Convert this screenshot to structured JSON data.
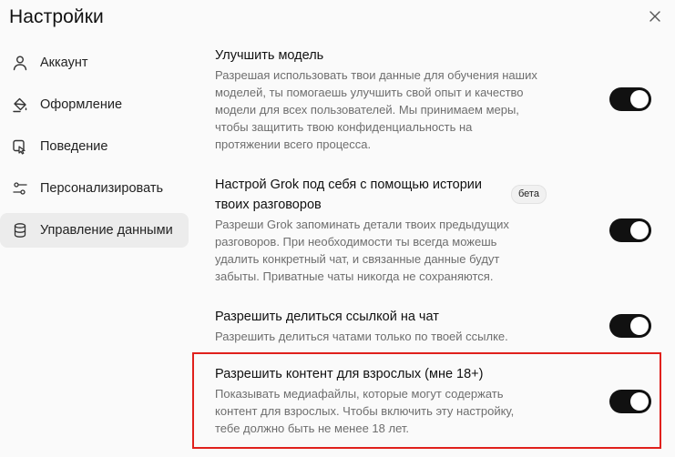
{
  "dialog": {
    "title": "Настройки"
  },
  "sidebar": {
    "items": [
      {
        "label": "Аккаунт",
        "icon": "user-icon"
      },
      {
        "label": "Оформление",
        "icon": "paint-bucket-icon"
      },
      {
        "label": "Поведение",
        "icon": "behavior-icon"
      },
      {
        "label": "Персонализировать",
        "icon": "sliders-icon"
      },
      {
        "label": "Управление данными",
        "icon": "database-icon",
        "active": true
      }
    ]
  },
  "settings": [
    {
      "title": "Улучшить модель",
      "description": [
        "Разрешая использовать твои данные для обучения наших",
        "моделей, ты помогаешь улучшить свой опыт и качество",
        "модели для всех пользователей. Мы принимаем меры,",
        "чтобы защитить твою конфиденциальность на",
        "протяжении всего процесса."
      ],
      "enabled": true
    },
    {
      "title": [
        "Настрой Grok под себя с помощью истории",
        "твоих разговоров"
      ],
      "badge": "бета",
      "description": [
        "Разреши Grok запоминать детали твоих предыдущих",
        "разговоров. При необходимости ты всегда можешь",
        "удалить конкретный чат, и связанные данные будут",
        "забыты. Приватные чаты никогда не сохраняются."
      ],
      "enabled": true
    },
    {
      "title": "Разрешить делиться ссылкой на чат",
      "description": [
        "Разрешить делиться чатами только по твоей ссылке."
      ],
      "enabled": true
    },
    {
      "title": "Разрешить контент для взрослых (мне 18+)",
      "description": [
        "Показывать медиафайлы, которые могут содержать",
        "контент для взрослых. Чтобы включить эту настройку,",
        "тебе должно быть не менее 18 лет."
      ],
      "enabled": true
    }
  ],
  "colors": {
    "background": "#fafafa",
    "active_nav": "#ececec",
    "toggle_on": "#111111",
    "highlight": "#e0201c",
    "description_text": "#6e6e6e"
  }
}
